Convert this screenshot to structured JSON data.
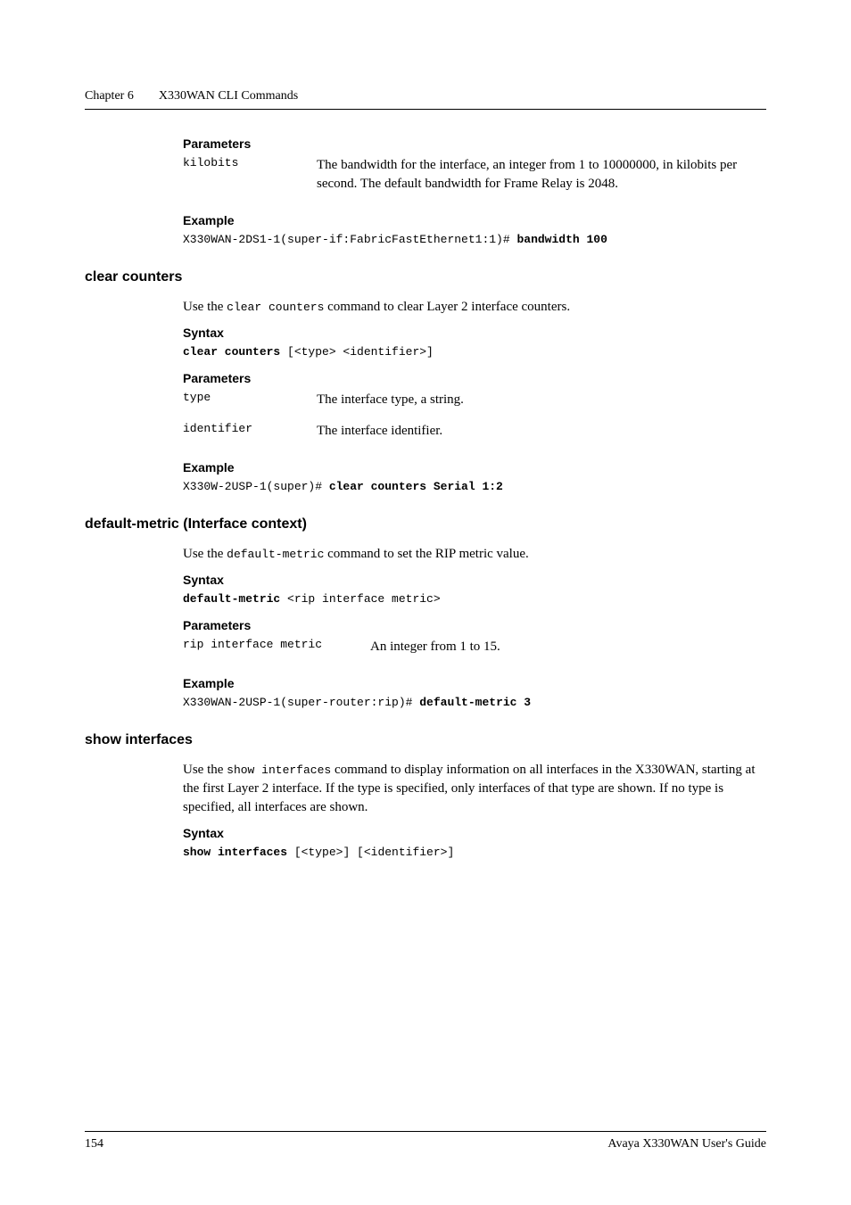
{
  "header": {
    "chapter": "Chapter 6",
    "title": "X330WAN CLI Commands"
  },
  "sections": {
    "bandwidth_params": {
      "heading": "Parameters",
      "name": "kilobits",
      "desc": "The bandwidth for the interface, an integer from 1 to 10000000, in kilobits per second. The default bandwidth for Frame Relay is 2048."
    },
    "bandwidth_example": {
      "heading": "Example",
      "prompt": "X330WAN-2DS1-1(super-if:FabricFastEthernet1:1)# ",
      "cmd": "bandwidth 100"
    },
    "clear_counters": {
      "heading": "clear counters",
      "intro_pre": "Use the ",
      "intro_code": "clear counters",
      "intro_post": " command to clear Layer 2 interface counters.",
      "syntax_heading": "Syntax",
      "syntax_bold": "clear counters",
      "syntax_rest": " [<type> <identifier>]",
      "params_heading": "Parameters",
      "param1_name": "type",
      "param1_desc": "The interface type, a string.",
      "param2_name": "identifier",
      "param2_desc": "The interface identifier.",
      "example_heading": "Example",
      "example_prompt": "X330W-2USP-1(super)# ",
      "example_cmd": "clear counters Serial 1:2"
    },
    "default_metric": {
      "heading": "default-metric (Interface context)",
      "intro_pre": "Use the ",
      "intro_code": "default-metric",
      "intro_post": " command to set the RIP metric value.",
      "syntax_heading": "Syntax",
      "syntax_bold": "default-metric",
      "syntax_rest": " <rip interface metric>",
      "params_heading": "Parameters",
      "param_name": "rip interface metric",
      "param_desc": "An integer from 1 to 15.",
      "example_heading": "Example",
      "example_prompt": "X330WAN-2USP-1(super-router:rip)# ",
      "example_cmd": "default-metric 3"
    },
    "show_interfaces": {
      "heading": "show interfaces",
      "intro_pre": "Use the ",
      "intro_code": "show interfaces",
      "intro_post": " command to display information on all interfaces in the X330WAN, starting at the first Layer 2 interface. If the type is specified, only interfaces of that type are shown. If no type is specified, all interfaces are shown.",
      "syntax_heading": "Syntax",
      "syntax_bold": "show interfaces",
      "syntax_rest": " [<type>] [<identifier>]"
    }
  },
  "footer": {
    "page": "154",
    "guide": "Avaya X330WAN User's Guide"
  }
}
